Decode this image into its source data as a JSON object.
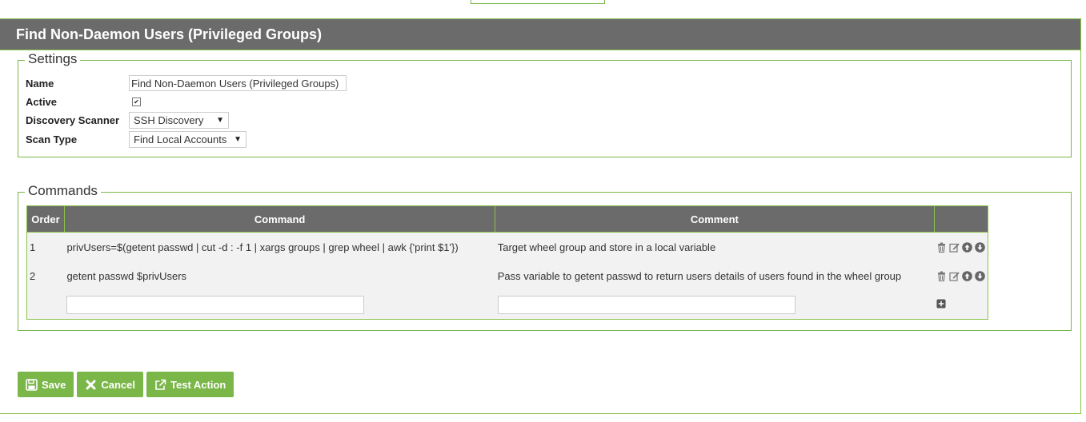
{
  "panel": {
    "title": "Find Non-Daemon Users (Privileged Groups)"
  },
  "settings": {
    "legend": "Settings",
    "name_label": "Name",
    "name_value": "Find Non-Daemon Users (Privileged Groups)",
    "active_label": "Active",
    "active_checked": true,
    "scanner_label": "Discovery Scanner",
    "scanner_value": "SSH Discovery",
    "scantype_label": "Scan Type",
    "scantype_value": "Find Local Accounts"
  },
  "commands": {
    "legend": "Commands",
    "headers": {
      "order": "Order",
      "command": "Command",
      "comment": "Comment"
    },
    "rows": [
      {
        "order": "1",
        "command": "privUsers=$(getent passwd | cut -d : -f 1 | xargs groups | grep wheel | awk {'print $1'})",
        "comment": "Target wheel group and store in a local variable"
      },
      {
        "order": "2",
        "command": "getent passwd $privUsers",
        "comment": "Pass variable to getent passwd to return users details of users found in the wheel group"
      }
    ],
    "new_command_value": "",
    "new_comment_value": ""
  },
  "buttons": {
    "save": "Save",
    "cancel": "Cancel",
    "test": "Test Action"
  },
  "colors": {
    "accent": "#7ab648",
    "header": "#6b6b6b"
  }
}
